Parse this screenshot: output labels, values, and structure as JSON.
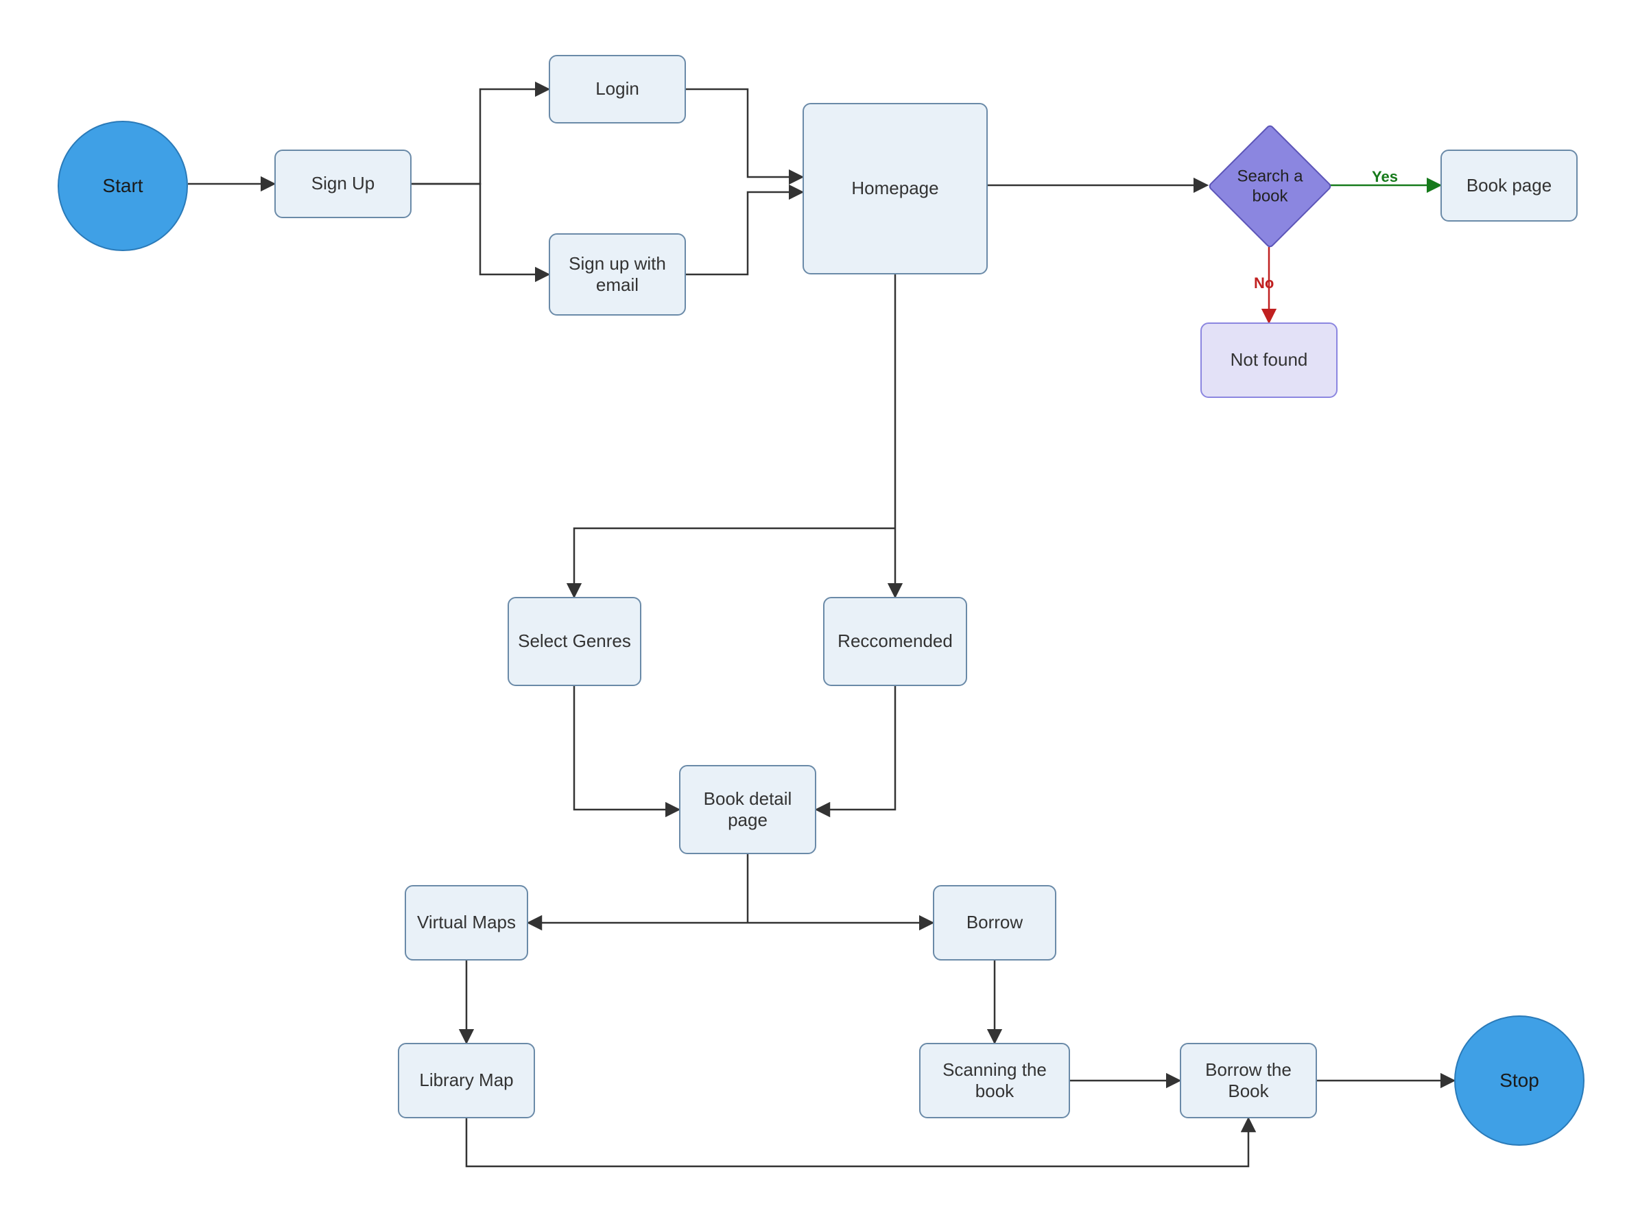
{
  "nodes": {
    "start": "Start",
    "signup": "Sign Up",
    "login": "Login",
    "signup_email": "Sign up with email",
    "homepage": "Homepage",
    "search": "Search a book",
    "bookpage": "Book page",
    "notfound": "Not found",
    "select_genres": "Select Genres",
    "recommended": "Reccomended",
    "book_detail": "Book detail page",
    "virtual_maps": "Virtual Maps",
    "borrow": "Borrow",
    "library_map": "Library Map",
    "scanning": "Scanning the book",
    "borrow_book": "Borrow the Book",
    "stop": "Stop"
  },
  "edge_labels": {
    "yes": "Yes",
    "no": "No"
  },
  "colors": {
    "box_fill": "#e9f1f8",
    "box_stroke": "#6a8aa8",
    "circle_fill": "#3fa0e6",
    "diamond_fill": "#8b86e0",
    "purple_fill": "#e3e1f7",
    "yes_edge": "#167a1b",
    "no_edge": "#c02020",
    "edge": "#333333"
  }
}
